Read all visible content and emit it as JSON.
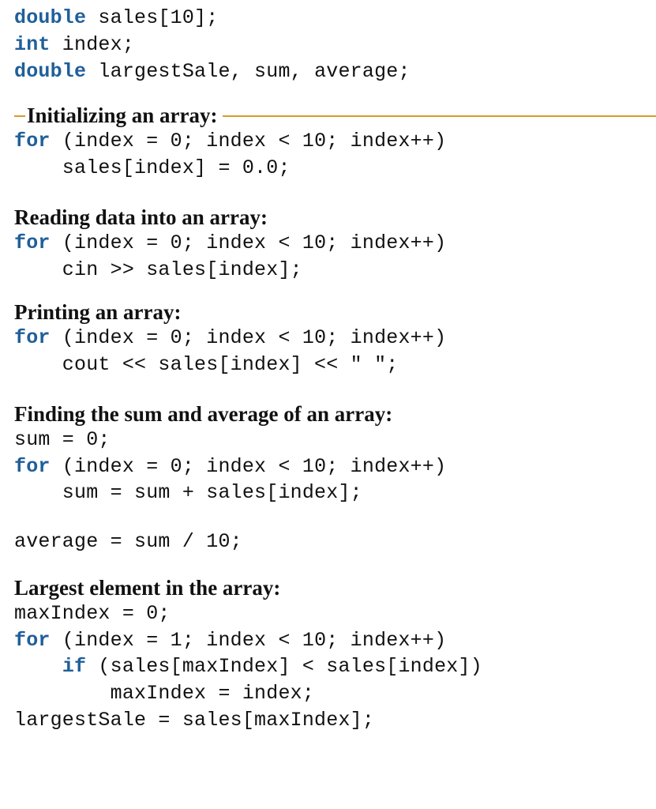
{
  "decl": {
    "kw1": "double",
    "line1_rest": " sales[10];",
    "kw2": "int",
    "line2_rest": " index;",
    "kw3": "double",
    "line3_rest": " largestSale, sum, average;"
  },
  "sections": {
    "init": {
      "title": "Initializing an array:",
      "kw": "for",
      "line1_rest": " (index = 0; index < 10; index++)",
      "line2": "    sales[index] = 0.0;"
    },
    "read": {
      "title": "Reading data into an array:",
      "kw": "for",
      "line1_rest": " (index = 0; index < 10; index++)",
      "line2": "    cin >> sales[index];"
    },
    "print": {
      "title": "Printing an array:",
      "kw": "for",
      "line1_rest": " (index = 0; index < 10; index++)",
      "line2": "    cout << sales[index] << \" \";"
    },
    "sum": {
      "title": "Finding the sum and average of an array:",
      "line0": "sum = 0;",
      "kw": "for",
      "line1_rest": " (index = 0; index < 10; index++)",
      "line2": "    sum = sum + sales[index];",
      "line3": "average = sum / 10;"
    },
    "largest": {
      "title": "Largest element in the array:",
      "line0": "maxIndex = 0;",
      "kw1": "for",
      "line1_rest": " (index = 1; index < 10; index++)",
      "kw2": "if",
      "line2_pre": "    ",
      "line2_rest": " (sales[maxIndex] < sales[index])",
      "line3": "        maxIndex = index;",
      "line4": "largestSale = sales[maxIndex];"
    }
  }
}
